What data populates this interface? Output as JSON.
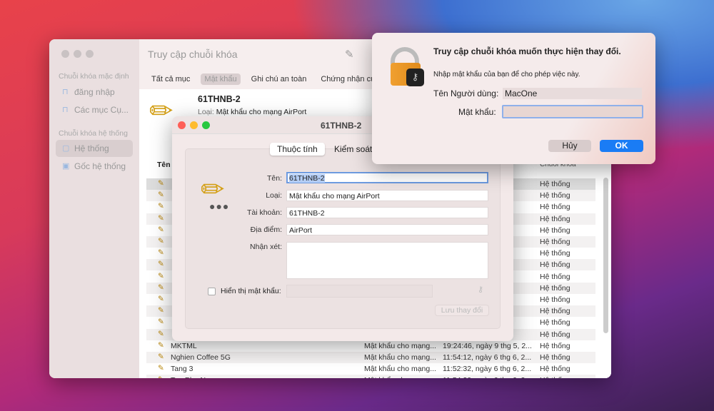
{
  "main": {
    "title": "Truy cập chuỗi khóa",
    "sidebar": {
      "sections": [
        "Chuỗi khóa mặc định",
        "Chuỗi khóa hệ thống"
      ],
      "items": [
        {
          "label": "đăng nhập",
          "icon": "unlock-icon"
        },
        {
          "label": "Các mục Cụ...",
          "icon": "unlock-icon"
        },
        {
          "label": "Hệ thống",
          "icon": "lock-icon"
        },
        {
          "label": "Gốc hệ thống",
          "icon": "cabinet-icon"
        }
      ]
    },
    "tabs": [
      "Tất cả mục",
      "Mật khẩu",
      "Ghi chú an toàn",
      "Chứng nhận của tôi"
    ],
    "selected_tab": "Mật khẩu",
    "item": {
      "name": "61THNB-2",
      "kind_label": "Loại:",
      "kind": "Mật khẩu cho mạng AirPort"
    },
    "columns": {
      "name": "Tên",
      "keychain": "Chuỗi khóa"
    },
    "rows": [
      {
        "n": "",
        "k": "",
        "d": "6, 2...",
        "c": "Hệ thống"
      },
      {
        "n": "",
        "k": "",
        "d": "6, 2...",
        "c": "Hệ thống"
      },
      {
        "n": "",
        "k": "",
        "d": "",
        "c": "Hệ thống"
      },
      {
        "n": "",
        "k": "",
        "d": "6, 2...",
        "c": "Hệ thống"
      },
      {
        "n": "",
        "k": "",
        "d": "1, 2...",
        "c": "Hệ thống"
      },
      {
        "n": "",
        "k": "",
        "d": "6, 2...",
        "c": "Hệ thống"
      },
      {
        "n": "",
        "k": "",
        "d": "6, 2...",
        "c": "Hệ thống"
      },
      {
        "n": "",
        "k": "",
        "d": "5, 2...",
        "c": "Hệ thống"
      },
      {
        "n": "",
        "k": "",
        "d": "g 5,...",
        "c": "Hệ thống"
      },
      {
        "n": "",
        "k": "",
        "d": "1, 2...",
        "c": "Hệ thống"
      },
      {
        "n": "",
        "k": "",
        "d": "g 11,...",
        "c": "Hệ thống"
      },
      {
        "n": "",
        "k": "",
        "d": "g 11,...",
        "c": "Hệ thống"
      },
      {
        "n": "",
        "k": "",
        "d": "11,...",
        "c": "Hệ thống"
      },
      {
        "n": "",
        "k": "",
        "d": "6, 20...",
        "c": "Hệ thống"
      },
      {
        "n": "MKTML",
        "k": "Mật khẩu cho mạng...",
        "d": "19:24:46, ngày 9 thg 5, 2...",
        "c": "Hệ thống"
      },
      {
        "n": "Nghien Coffee 5G",
        "k": "Mật khẩu cho mạng...",
        "d": "11:54:12, ngày 6 thg 6, 2...",
        "c": "Hệ thống"
      },
      {
        "n": "Tang 3",
        "k": "Mật khẩu cho mạng...",
        "d": "11:52:32, ngày 6 thg 6, 2...",
        "c": "Hệ thống"
      },
      {
        "n": "Tao Pho No",
        "k": "Mật khẩu cho mạng...",
        "d": "11:54:20, ngày 6 thg 6, 2...",
        "c": "Hệ thống"
      }
    ]
  },
  "detail": {
    "title": "61THNB-2",
    "tabs": [
      "Thuộc tính",
      "Kiểm soát"
    ],
    "fields": {
      "name_label": "Tên:",
      "name": "61THNB-2",
      "kind_label": "Loại:",
      "kind": "Mật khẩu cho mạng AirPort",
      "account_label": "Tài khoản:",
      "account": "61THNB-2",
      "where_label": "Địa điểm:",
      "where": "AirPort",
      "comment_label": "Nhận xét:",
      "comment": ""
    },
    "show_password_label": "Hiển thị mật khẩu:",
    "show_password": false,
    "save": "Lưu thay đổi"
  },
  "auth": {
    "title": "Truy cập chuỗi khóa muốn thực hiện thay đổi.",
    "message": "Nhập mật khẩu của bạn để cho phép việc này.",
    "user_label": "Tên Người dùng:",
    "user": "MacOne",
    "password_label": "Mật khẩu:",
    "password": "",
    "cancel": "Hủy",
    "ok": "OK",
    "accent": "#1a7cf5"
  }
}
